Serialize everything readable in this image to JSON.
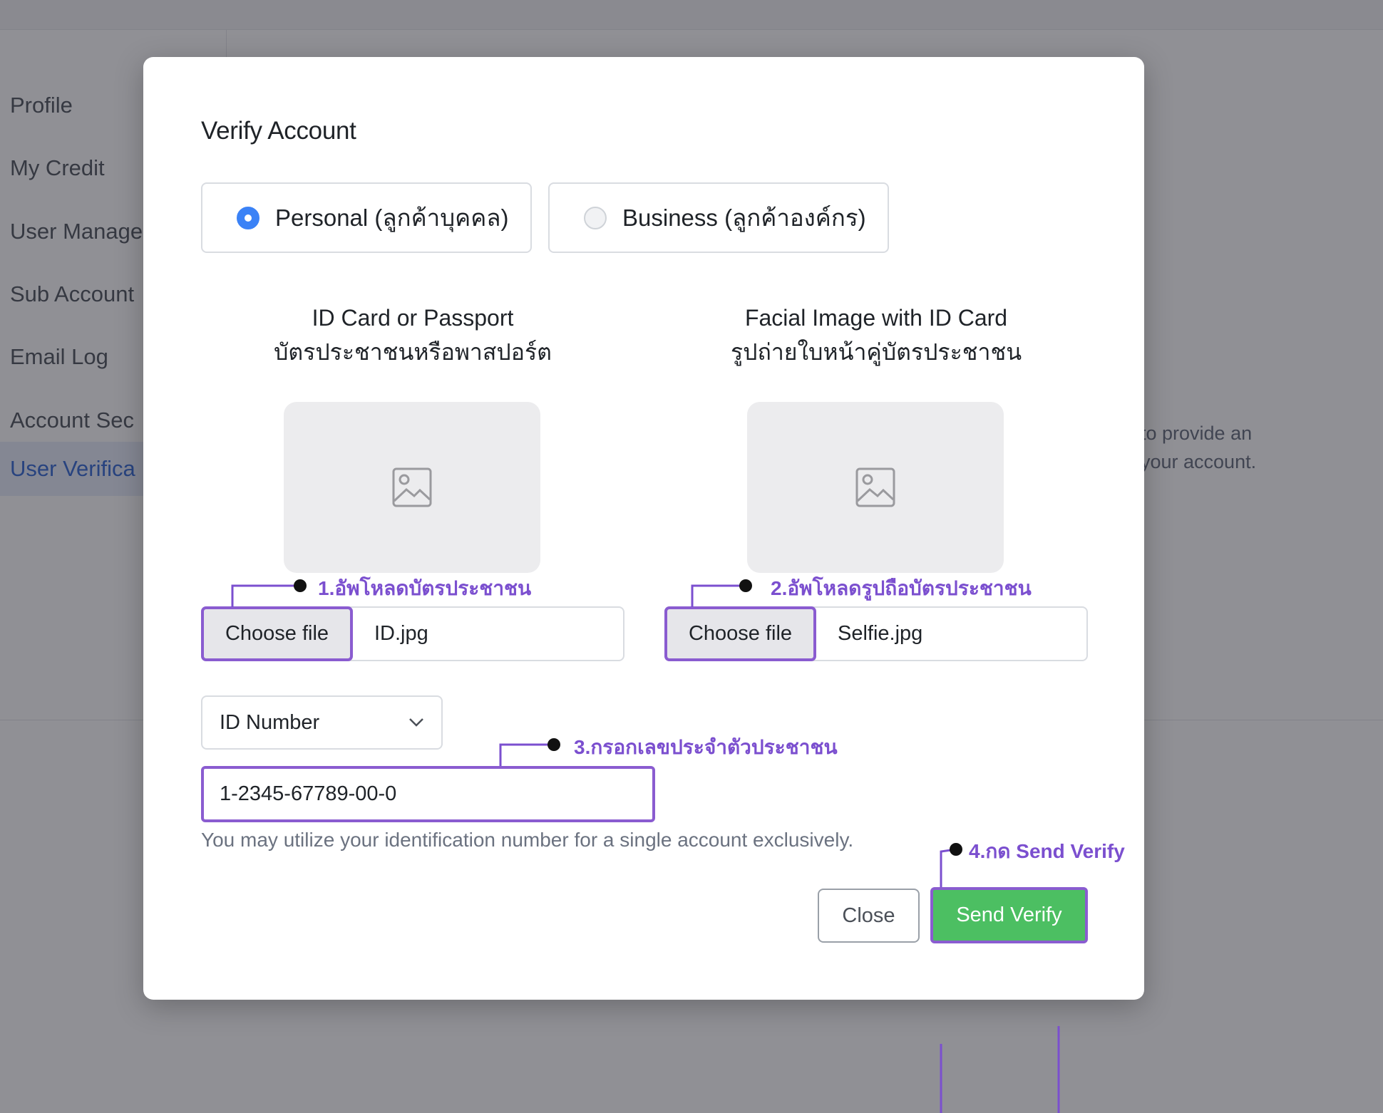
{
  "sidebar": {
    "items": [
      {
        "label": "Profile"
      },
      {
        "label": "My Credit"
      },
      {
        "label": "User Manage"
      },
      {
        "label": "Sub Account"
      },
      {
        "label": "Email Log"
      },
      {
        "label": "Account Sec"
      },
      {
        "label": "User Verifica"
      }
    ],
    "active_index": 6
  },
  "background_content": {
    "line1": "to provide an",
    "line2": "your account."
  },
  "modal": {
    "title": "Verify Account",
    "account_types": {
      "personal": {
        "label": "Personal (ลูกค้าบุคคล)",
        "selected": true
      },
      "business": {
        "label": "Business (ลูกค้าองค์กร)",
        "selected": false
      }
    },
    "uploads": {
      "id_card": {
        "heading_en": "ID Card or Passport",
        "heading_th": "บัตรประชาชนหรือพาสปอร์ต",
        "button_label": "Choose file",
        "file_name": "ID.jpg"
      },
      "selfie": {
        "heading_en": "Facial Image with ID Card",
        "heading_th": "รูปถ่ายใบหน้าคู่บัตรประชาชน",
        "button_label": "Choose file",
        "file_name": "Selfie.jpg"
      }
    },
    "id_type_select": {
      "selected": "ID Number"
    },
    "id_number_input": {
      "value": "1-2345-67789-00-0"
    },
    "helper_text": "You may utilize your identification number for a single account exclusively.",
    "buttons": {
      "close": "Close",
      "send_verify": "Send Verify"
    }
  },
  "annotations": {
    "step1": "1.อัพโหลดบัตรประชาชน",
    "step2": "2.อัพโหลดรูปถือบัตรประชาชน",
    "step3": "3.กรอกเลขประจำตัวประชาชน",
    "step4": "4.กด Send Verify"
  },
  "colors": {
    "annotation": "#7b4fcf",
    "primary_radio": "#3b82f6",
    "send_button": "#4cbf62",
    "overlay": "rgba(20,20,30,0.47)"
  }
}
